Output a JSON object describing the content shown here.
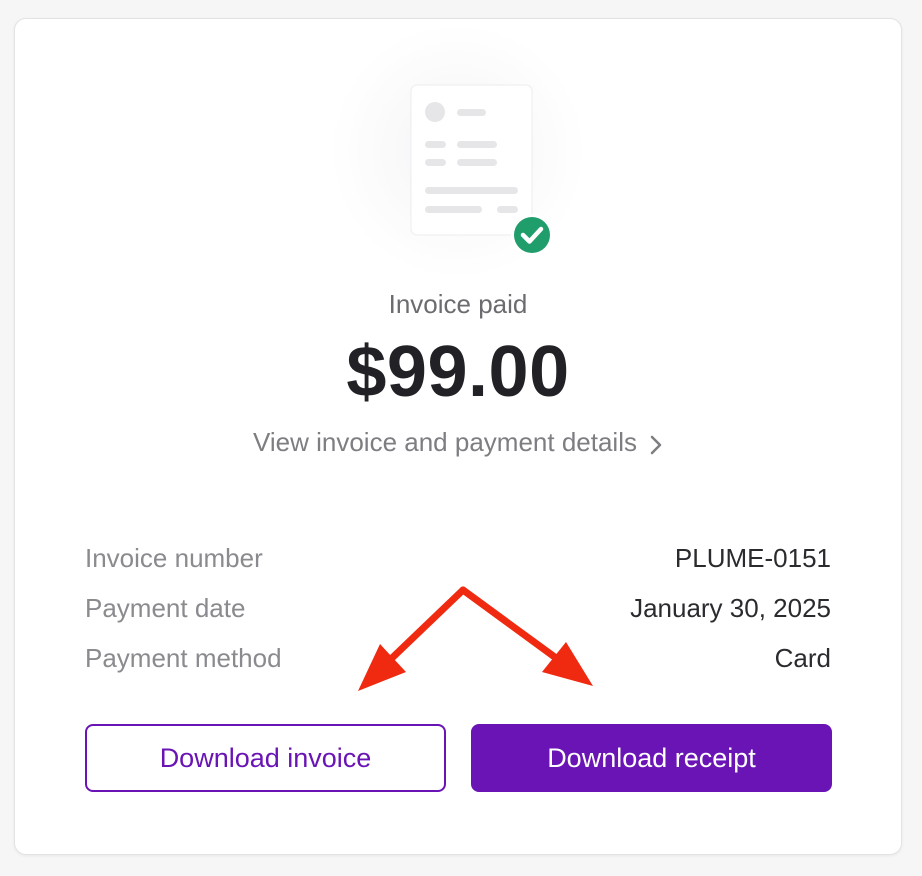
{
  "status_text": "Invoice paid",
  "amount": "$99.00",
  "details_link": "View invoice and payment details",
  "info": [
    {
      "label": "Invoice number",
      "value": "PLUME-0151"
    },
    {
      "label": "Payment date",
      "value": "January 30, 2025"
    },
    {
      "label": "Payment method",
      "value": "Card"
    }
  ],
  "buttons": {
    "download_invoice": "Download invoice",
    "download_receipt": "Download receipt"
  },
  "icons": {
    "illustration": "invoice-document-icon",
    "badge": "checkmark-circle-icon",
    "chevron": "chevron-right-icon"
  },
  "colors": {
    "accent": "#6a14b5",
    "success": "#1f9d6a",
    "annotation_arrow": "#f02a10"
  }
}
